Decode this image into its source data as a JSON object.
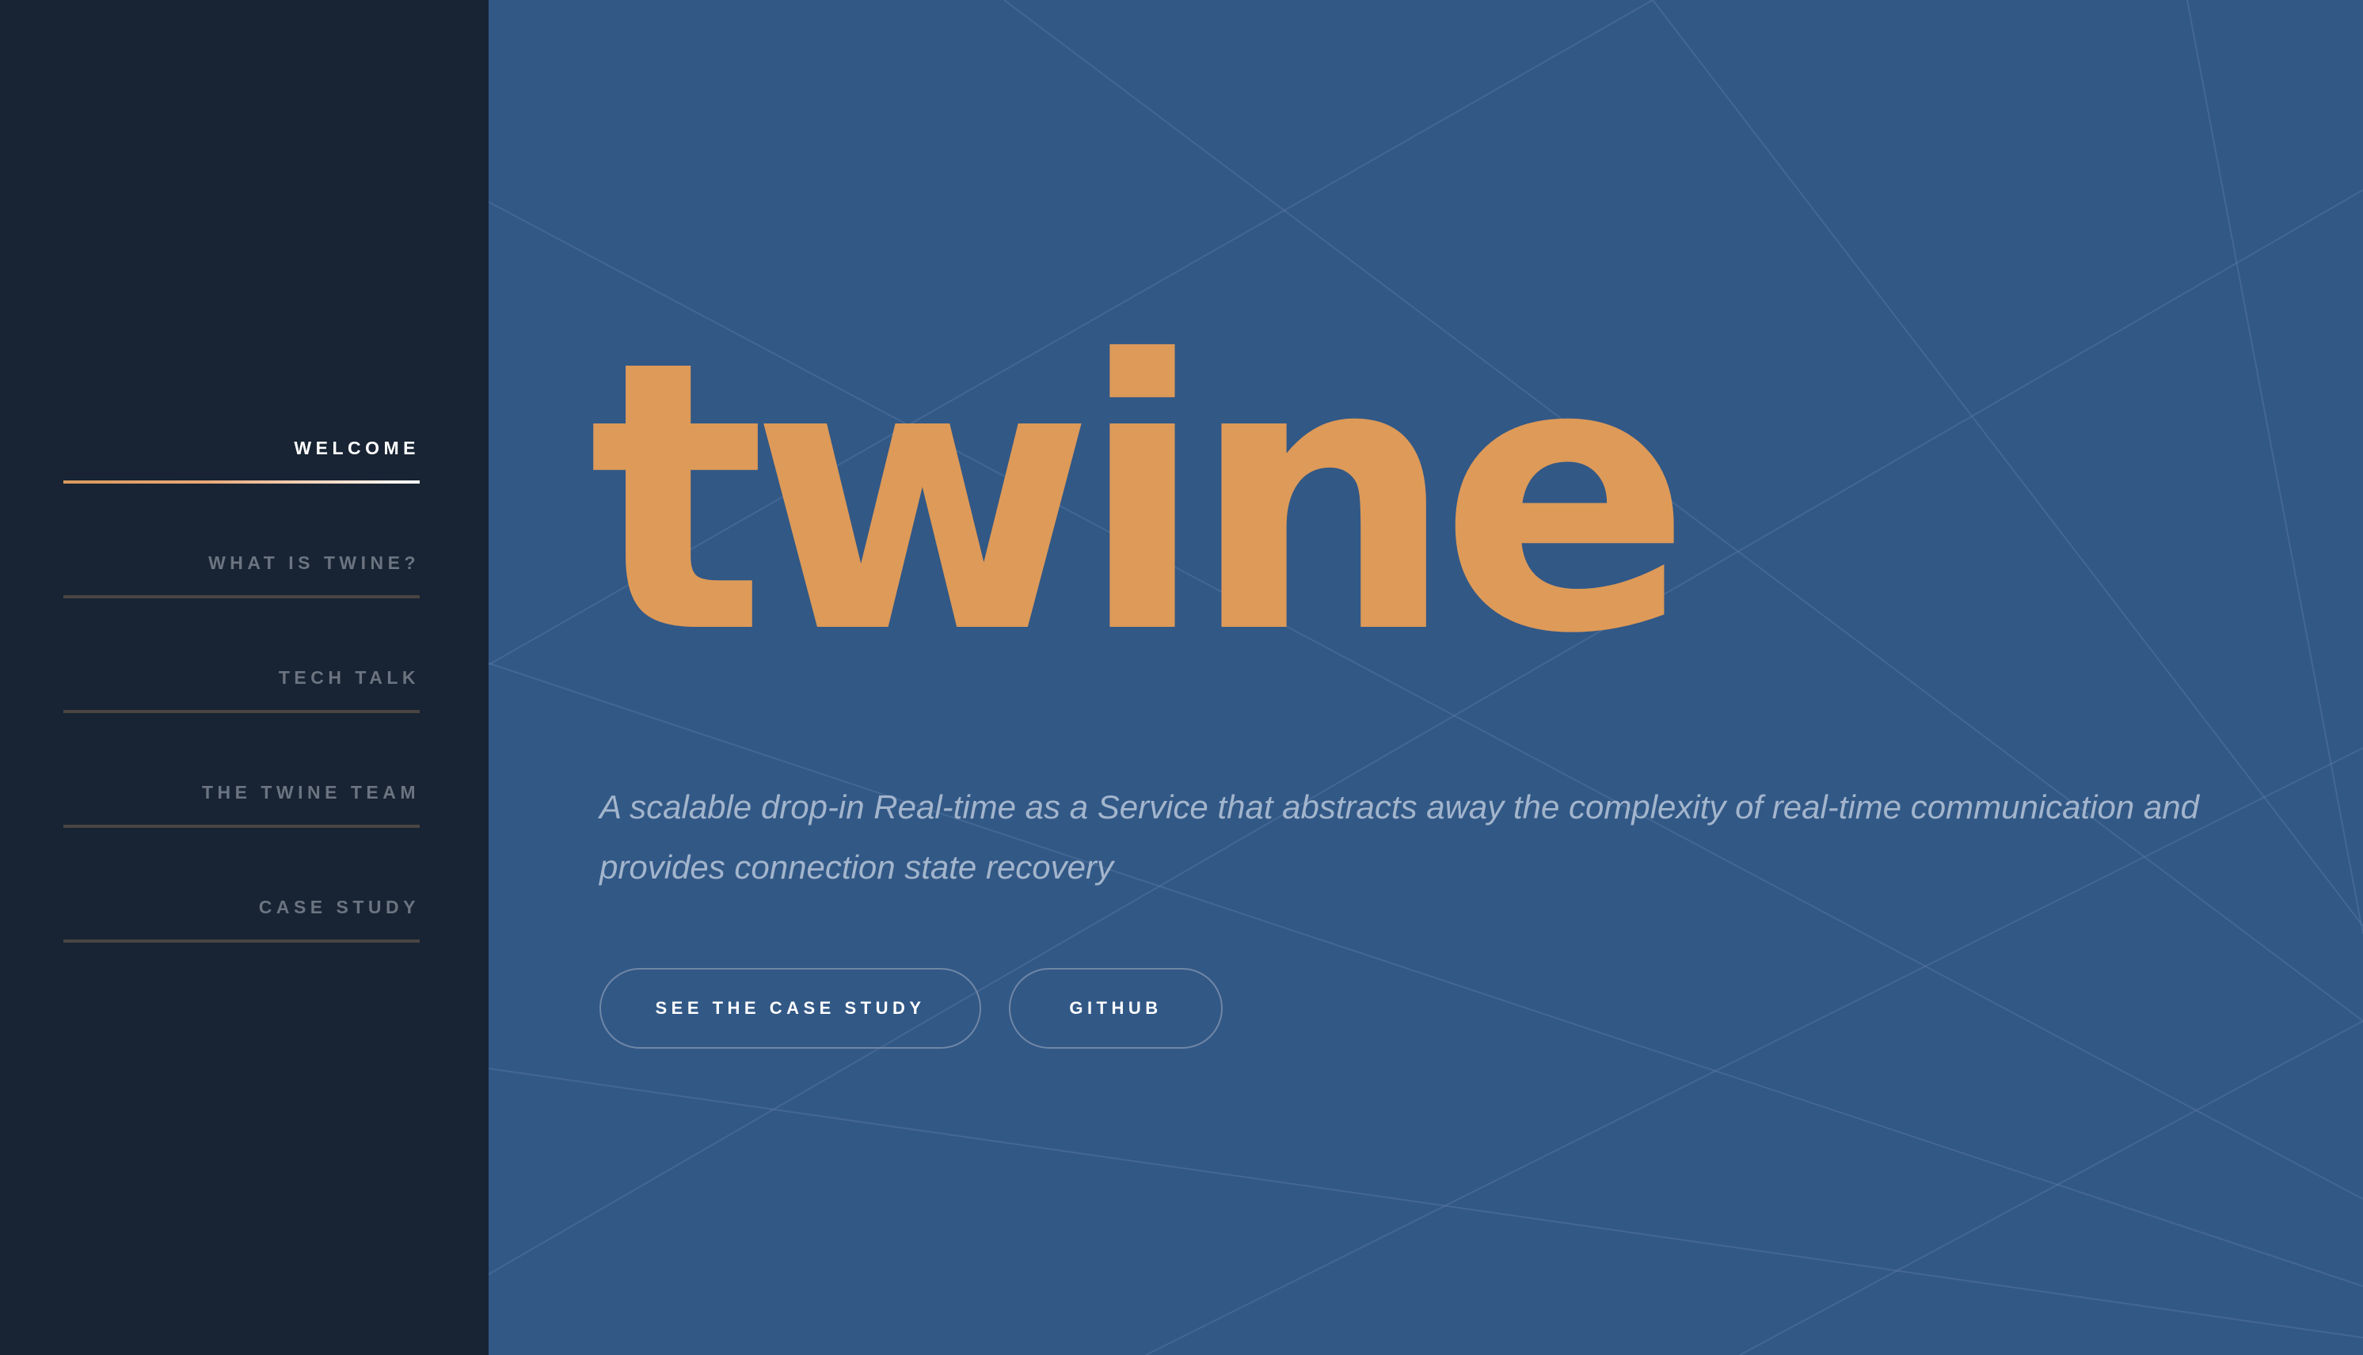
{
  "sidebar": {
    "nav_items": [
      {
        "label": "WELCOME",
        "active": true
      },
      {
        "label": "WHAT IS TWINE?",
        "active": false
      },
      {
        "label": "TECH TALK",
        "active": false
      },
      {
        "label": "THE TWINE TEAM",
        "active": false
      },
      {
        "label": "CASE STUDY",
        "active": false
      }
    ]
  },
  "hero": {
    "title": "twine",
    "tagline": "A scalable drop-in Real-time as a Service that abstracts away the complexity of real-time communication and provides connection state recovery",
    "buttons": {
      "case_study": "SEE THE CASE STUDY",
      "github": "GITHUB"
    }
  },
  "colors": {
    "sidebar_bg": "#182433",
    "main_bg": "#325886",
    "accent": "#dd9a58",
    "active_text": "#ffffff",
    "inactive_text": "#6b7480"
  }
}
